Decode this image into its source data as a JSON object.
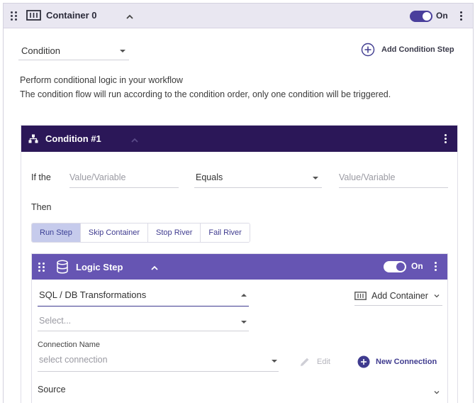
{
  "container": {
    "title": "Container 0",
    "toggle_label": "On",
    "toggle_on": true
  },
  "condition_select": {
    "value": "Condition"
  },
  "add_condition_step": {
    "label": "Add Condition Step"
  },
  "description": {
    "line1": "Perform conditional logic in your workflow",
    "line2": "The condition flow will run according to the condition order, only one condition will be triggered."
  },
  "condition_card": {
    "title": "Condition #1",
    "if_label": "If the",
    "left_placeholder": "Value/Variable",
    "operator": "Equals",
    "right_placeholder": "Value/Variable",
    "then_label": "Then",
    "tabs": [
      {
        "label": "Run Step",
        "active": true
      },
      {
        "label": "Skip Container",
        "active": false
      },
      {
        "label": "Stop River",
        "active": false
      },
      {
        "label": "Fail River",
        "active": false
      }
    ]
  },
  "logic_step": {
    "title": "Logic Step",
    "toggle_label": "On",
    "toggle_on": true,
    "type_select": "SQL / DB Transformations",
    "sub_select_placeholder": "Select...",
    "add_container_label": "Add Container",
    "connection_label": "Connection Name",
    "connection_placeholder": "select connection",
    "edit_label": "Edit",
    "new_connection_label": "New Connection",
    "source_label": "Source"
  },
  "colors": {
    "outer_header_bg": "#e9e7f1",
    "condition_header_bg": "#2b1758",
    "logic_header_bg": "#6655b3",
    "toggle_on": "#4a3f9c",
    "accent": "#3f3b8f",
    "active_tab_bg": "#c6cbec"
  },
  "icons": {
    "drag_handle": "drag-handle-icon",
    "container": "container-icon",
    "chevron_up": "chevron-up-icon",
    "kebab": "more-vertical-icon",
    "add_circle": "add-circle-outline-icon",
    "hierarchy": "hierarchy-icon",
    "database": "database-icon",
    "pencil": "pencil-icon",
    "add_filled": "add-circle-filled-icon",
    "chevron_down": "chevron-down-icon"
  }
}
